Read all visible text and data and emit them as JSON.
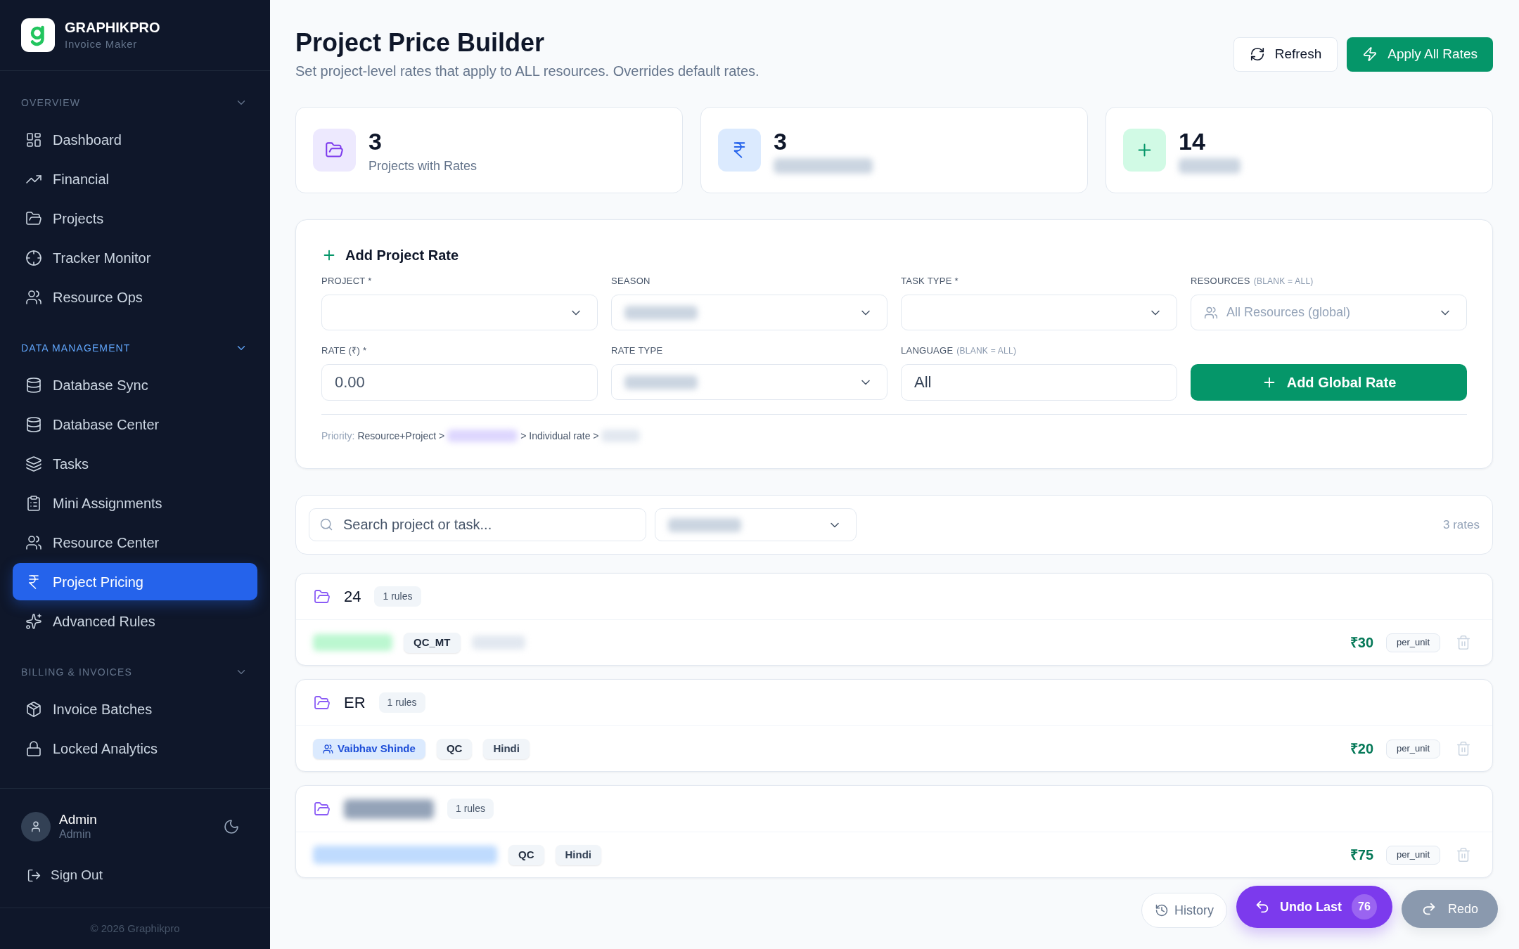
{
  "sidebar": {
    "brand": {
      "name": "GRAPHIKPRO",
      "tagline": "Invoice Maker"
    },
    "sections": [
      {
        "title": "OVERVIEW",
        "active": false,
        "expanded": true,
        "items": [
          {
            "label": "Dashboard",
            "selected": false
          },
          {
            "label": "Financial",
            "selected": false
          },
          {
            "label": "Projects",
            "selected": false
          },
          {
            "label": "Tracker Monitor",
            "selected": false
          },
          {
            "label": "Resource Ops",
            "selected": false
          }
        ]
      },
      {
        "title": "DATA MANAGEMENT",
        "active": true,
        "expanded": true,
        "items": [
          {
            "label": "Database Sync",
            "selected": false
          },
          {
            "label": "Database Center",
            "selected": false
          },
          {
            "label": "Tasks",
            "selected": false
          },
          {
            "label": "Mini Assignments",
            "selected": false
          },
          {
            "label": "Resource Center",
            "selected": false
          },
          {
            "label": "Project Pricing",
            "selected": true
          },
          {
            "label": "Advanced Rules",
            "selected": false
          }
        ]
      },
      {
        "title": "BILLING & INVOICES",
        "active": false,
        "expanded": true,
        "items": [
          {
            "label": "Invoice Batches",
            "selected": false
          },
          {
            "label": "Locked Analytics",
            "selected": false
          }
        ]
      }
    ],
    "user": {
      "name": "Admin",
      "role": "Admin"
    },
    "sign_out": "Sign Out",
    "copyright": "© 2026 Graphikpro"
  },
  "header": {
    "title": "Project Price Builder",
    "subtitle": "Set project-level rates that apply to ALL resources. Overrides default rates.",
    "actions": [
      {
        "label": "Refresh",
        "kind": "secondary"
      },
      {
        "label": "Apply All Rates",
        "kind": "primary"
      }
    ]
  },
  "stats": [
    {
      "value": "3",
      "label": "Projects with Rates",
      "blurred": false
    },
    {
      "value": "3",
      "blurred": true
    },
    {
      "value": "14",
      "blurred": true
    }
  ],
  "form": {
    "title": "Add Project Rate",
    "fields": [
      {
        "label": "PROJECT *",
        "kind": "select",
        "blurred": false
      },
      {
        "label": "SEASON",
        "kind": "select",
        "blurred": true
      },
      {
        "label": "TASK TYPE *",
        "kind": "select",
        "blurred": false
      },
      {
        "label": "RESOURCES",
        "hint": "(BLANK = ALL)",
        "kind": "people_select",
        "placeholder": "All Resources (global)",
        "blurred": false
      },
      {
        "label": "RATE (₹) *",
        "kind": "input",
        "placeholder": "0.00"
      },
      {
        "label": "RATE TYPE",
        "kind": "select",
        "blurred": true
      },
      {
        "label": "LANGUAGE",
        "hint": "(BLANK = ALL)",
        "kind": "input",
        "value": "All"
      }
    ],
    "submit": "Add Global Rate",
    "priority": {
      "label": "Priority:",
      "steps": [
        {
          "text": "Resource+Project >",
          "blurred": false
        },
        {
          "blurred": true
        },
        {
          "text": "> Individual rate >",
          "blurred": false
        },
        {
          "blurred": true
        }
      ]
    }
  },
  "filter_bar": {
    "search": {
      "placeholder": "Search project or task..."
    },
    "filter": {
      "blurred": true
    },
    "count": "3 rates"
  },
  "groups": [
    {
      "name": "24",
      "blurred": false,
      "count": "1 rules",
      "rules": [
        {
          "tags": [
            {
              "kind": "scope",
              "blurred": true
            },
            {
              "kind": "task",
              "text": "QC_MT",
              "blurred": false
            },
            {
              "kind": "language",
              "blurred": true
            }
          ],
          "amount": "₹30",
          "unit": "per_unit"
        }
      ]
    },
    {
      "name": "ER",
      "blurred": false,
      "count": "1 rules",
      "rules": [
        {
          "tags": [
            {
              "kind": "resource",
              "text": "Vaibhav Shinde",
              "blurred": false
            },
            {
              "kind": "task",
              "text": "QC",
              "blurred": false
            },
            {
              "kind": "language",
              "text": "Hindi",
              "blurred": false
            }
          ],
          "amount": "₹20",
          "unit": "per_unit"
        }
      ]
    },
    {
      "blurred": true,
      "count": "1 rules",
      "rules": [
        {
          "tags": [
            {
              "kind": "resource",
              "blurred": true
            },
            {
              "kind": "task",
              "text": "QC",
              "blurred": false
            },
            {
              "kind": "language",
              "text": "Hindi",
              "blurred": false
            }
          ],
          "amount": "₹75",
          "unit": "per_unit"
        }
      ]
    }
  ],
  "history_bar": {
    "history": "History",
    "undo": {
      "label": "Undo Last",
      "count": "76"
    },
    "redo": {
      "label": "Redo",
      "disabled": true
    }
  }
}
